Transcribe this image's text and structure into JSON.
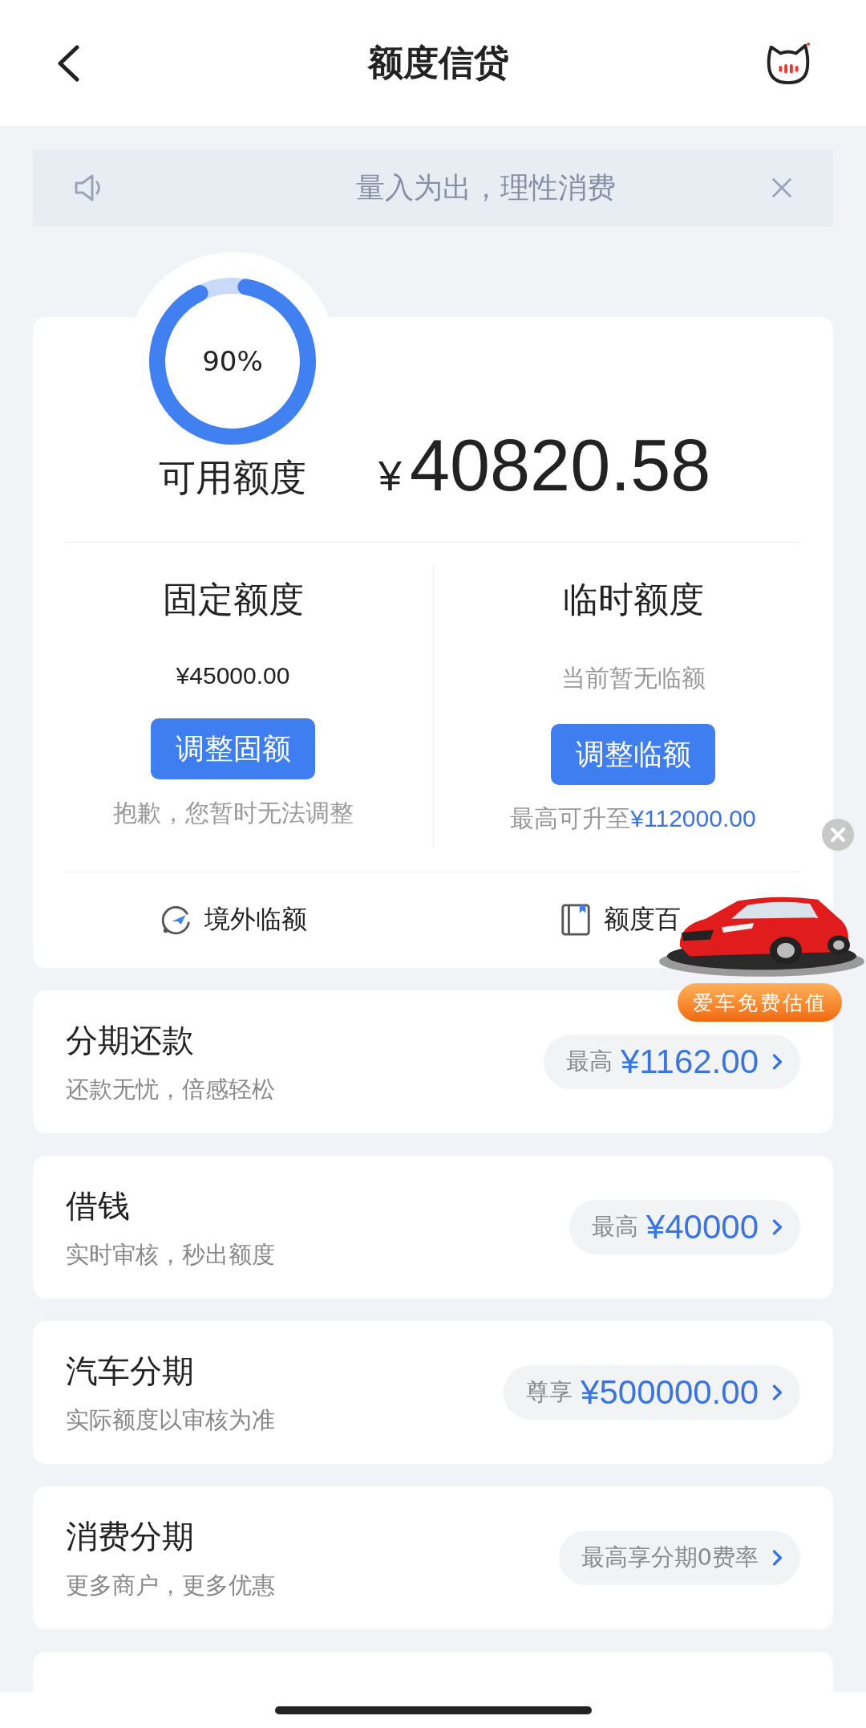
{
  "header": {
    "title": "额度信贷"
  },
  "notice": {
    "text": "量入为出，理性消费"
  },
  "available": {
    "level": 0.9,
    "percent": "90%",
    "label": "可用额度",
    "currency": "¥",
    "amount": "40820.58"
  },
  "quotas": [
    {
      "title": "固定额度",
      "value": "¥45000.00",
      "value_muted": false,
      "button": "调整固额",
      "note": "抱歉，您暂时无法调整"
    },
    {
      "title": "临时额度",
      "value": "当前暂无临额",
      "value_muted": true,
      "button": "调整临额",
      "note": "最高可升至",
      "note_amount": "¥112000.00"
    }
  ],
  "links": [
    {
      "kind": "travel",
      "label": "境外临额"
    },
    {
      "kind": "book",
      "label": "额度百"
    }
  ],
  "products": [
    {
      "title": "分期还款",
      "subtitle": "还款无忧，倍感轻松",
      "pill_prefix": "最高",
      "pill_value": "¥1162.00"
    },
    {
      "title": "借钱",
      "subtitle": "实时审核，秒出额度",
      "pill_prefix": "最高",
      "pill_value": "¥40000"
    },
    {
      "title": "汽车分期",
      "subtitle": "实际额度以审核为准",
      "pill_prefix": "尊享",
      "pill_value": "¥500000.00"
    },
    {
      "title": "消费分期",
      "subtitle": "更多商户，更多优惠",
      "pill_label": "最高享分期0费率"
    }
  ],
  "cut_card": true,
  "car_ad": {
    "kind": "picture",
    "button": "爱车免费估值"
  }
}
